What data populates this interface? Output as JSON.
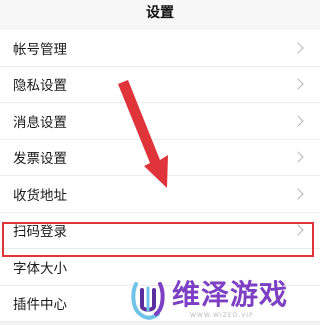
{
  "header": {
    "title": "设置"
  },
  "settings": {
    "items": [
      {
        "label": "帐号管理"
      },
      {
        "label": "隐私设置"
      },
      {
        "label": "消息设置"
      },
      {
        "label": "发票设置"
      },
      {
        "label": "收货地址"
      },
      {
        "label": "扫码登录"
      },
      {
        "label": "字体大小"
      },
      {
        "label": "插件中心"
      }
    ]
  },
  "annotation": {
    "highlight_color": "#e0343b",
    "arrow_color": "#e0343b"
  },
  "watermark": {
    "brand": "维泽游戏",
    "sub": "WWW.WIZED.VIP",
    "color": "#7d3fc4"
  }
}
